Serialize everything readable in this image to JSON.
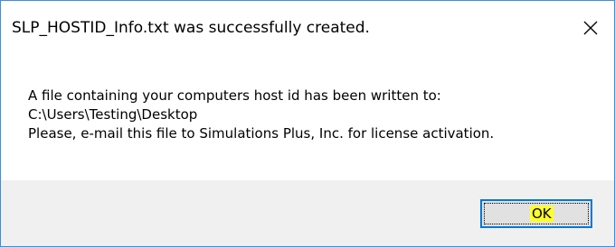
{
  "dialog": {
    "title": "SLP_HOSTID_Info.txt was successfully created.",
    "close_icon": "close-icon",
    "message": {
      "line1": "A file containing your computers host id has been written to:",
      "line2": "C:\\Users\\Testing\\Desktop",
      "line3": "Please, e-mail this file to Simulations Plus, Inc. for license activation."
    },
    "ok_label": "OK"
  },
  "colors": {
    "border": "#3c8fd6",
    "footer_bg": "#f0f0f0",
    "button_border": "#0078d7",
    "button_bg": "#e1e1e1",
    "highlight": "#ffff2b"
  }
}
